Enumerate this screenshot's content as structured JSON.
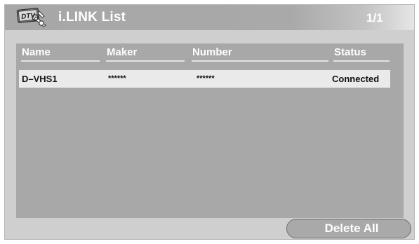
{
  "titlebar": {
    "logo_text": "DTV",
    "title": "i.LINK List",
    "page_indicator": "1/1"
  },
  "table": {
    "columns": [
      "Name",
      "Maker",
      "Number",
      "Status"
    ],
    "rows": [
      {
        "name": "D–VHS1",
        "maker": "******",
        "number": "******",
        "status": "Connected"
      }
    ]
  },
  "buttons": {
    "delete_all": "Delete All"
  },
  "colors": {
    "panel_bg": "#cfcfcf",
    "list_bg": "#a8a8a8",
    "row_bg": "#eaeaea",
    "header_text": "#ffffff"
  },
  "icons": [
    "dtv-logo-icon"
  ]
}
